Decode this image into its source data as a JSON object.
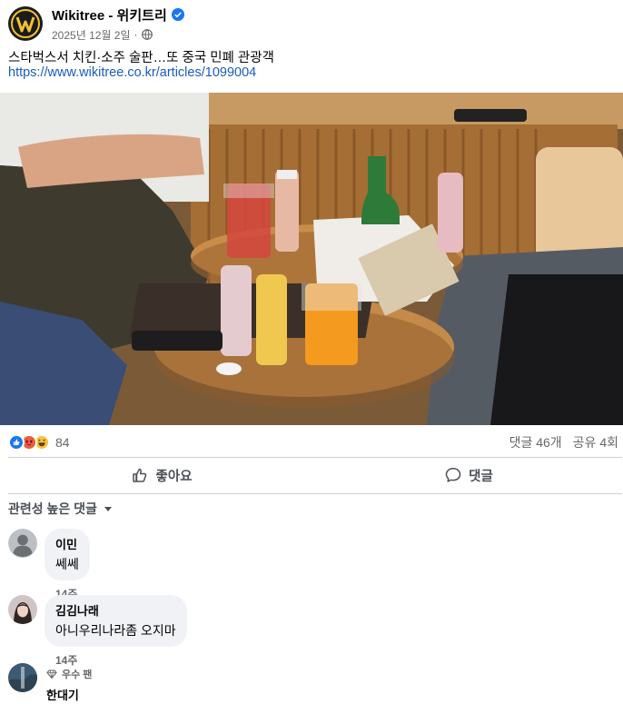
{
  "post": {
    "page_name": "Wikitree - 위키트리",
    "date": "2025년 12월 2일",
    "separator": "·",
    "text": "스타벅스서 치킨·소주 술판…또 중국 민폐 관광객",
    "link": "https://www.wikitree.co.kr/articles/1099004"
  },
  "reactions": {
    "count": "84",
    "comments": "댓글 46개",
    "shares": "공유 4회",
    "icons": [
      "like-icon",
      "angry-icon",
      "haha-icon"
    ]
  },
  "actions": {
    "like_label": "좋아요",
    "comment_label": "댓글"
  },
  "comments_section": {
    "sort_label": "관련성 높은 댓글"
  },
  "comments": [
    {
      "author": "이민",
      "text": "쎄쎄",
      "time": "14주"
    },
    {
      "author": "김김나래",
      "text": "아니우리나라좀 오지마",
      "time": "14주"
    },
    {
      "badge": "우수 팬",
      "author": "한대기"
    }
  ],
  "colors": {
    "link": "#1a5bbf",
    "verified": "#1877f2",
    "secondary_text": "#65676b",
    "bubble": "#f0f2f5"
  }
}
